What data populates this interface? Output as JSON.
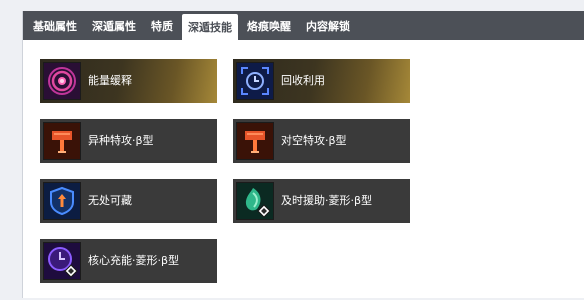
{
  "tabs": [
    {
      "label": "基础属性",
      "active": false
    },
    {
      "label": "深遁属性",
      "active": false
    },
    {
      "label": "特质",
      "active": false
    },
    {
      "label": "深遁技能",
      "active": true
    },
    {
      "label": "烙痕唤醒",
      "active": false
    },
    {
      "label": "内容解锁",
      "active": false
    }
  ],
  "skills": [
    {
      "label": "能量缓释",
      "icon": "energy-ring-icon",
      "style": "gold"
    },
    {
      "label": "回收利用",
      "icon": "clock-recycle-icon",
      "style": "gold"
    },
    {
      "label": "异种特攻·β型",
      "icon": "hammer-icon",
      "style": "dark"
    },
    {
      "label": "对空特攻·β型",
      "icon": "hammer-icon",
      "style": "dark"
    },
    {
      "label": "无处可藏",
      "icon": "shield-arrow-icon",
      "style": "dark"
    },
    {
      "label": "及时援助·菱形·β型",
      "icon": "green-crystal-icon",
      "style": "dark"
    },
    {
      "label": "核心充能·菱形·β型",
      "icon": "purple-clock-icon",
      "style": "dark"
    }
  ],
  "colors": {
    "tabbar": "#4c5057",
    "card": "#3a3a3a",
    "gold_accent": "#a58838"
  }
}
